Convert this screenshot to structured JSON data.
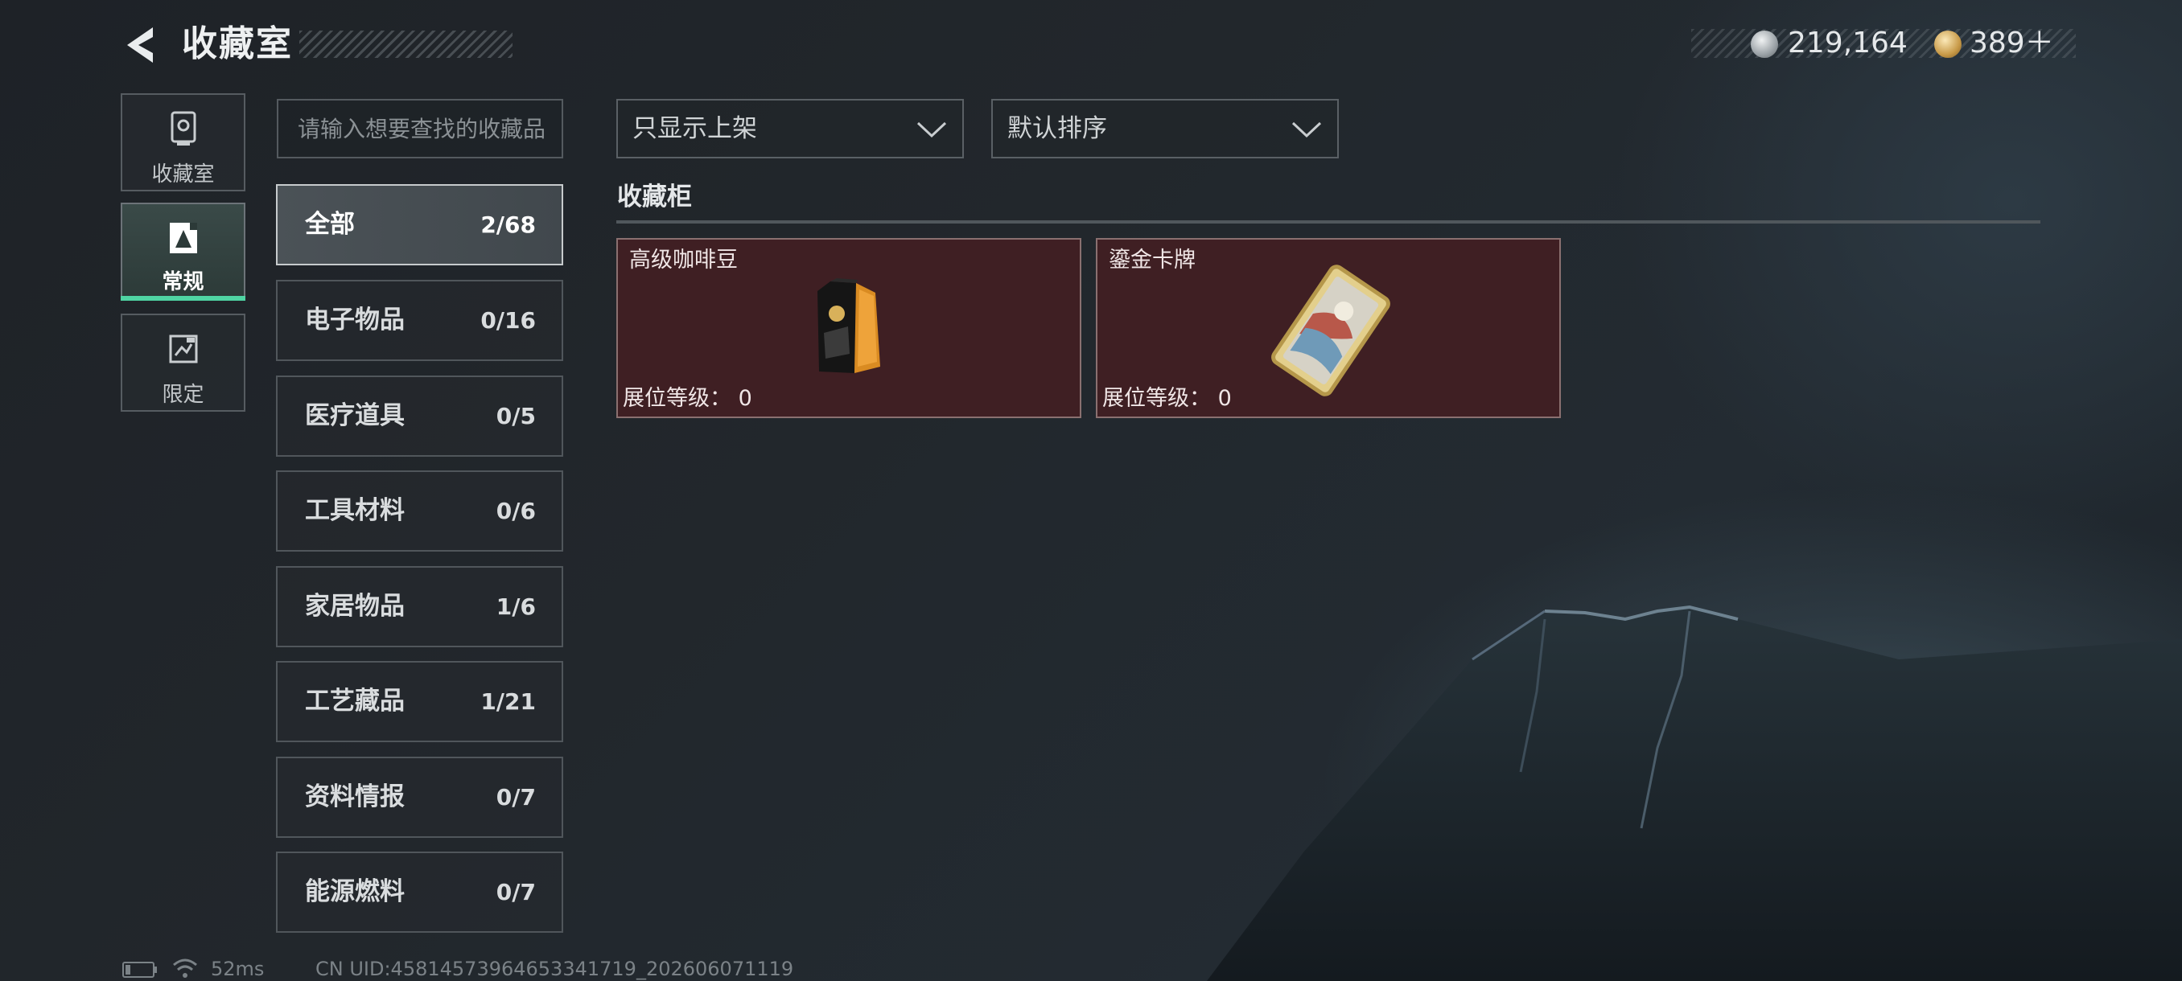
{
  "header": {
    "title": "收藏室",
    "silver_amount": "219,164",
    "gold_amount": "389＋"
  },
  "side_nav": {
    "items": [
      {
        "label": "收藏室",
        "icon": "collection-room-icon",
        "active": false
      },
      {
        "label": "常规",
        "icon": "regular-icon",
        "active": true
      },
      {
        "label": "限定",
        "icon": "limited-icon",
        "active": false
      }
    ]
  },
  "search": {
    "placeholder": "请输入想要查找的收藏品",
    "value": ""
  },
  "categories": [
    {
      "name": "全部",
      "count": "2/68",
      "active": true
    },
    {
      "name": "电子物品",
      "count": "0/16"
    },
    {
      "name": "医疗道具",
      "count": "0/5"
    },
    {
      "name": "工具材料",
      "count": "0/6"
    },
    {
      "name": "家居物品",
      "count": "1/6"
    },
    {
      "name": "工艺藏品",
      "count": "1/21"
    },
    {
      "name": "资料情报",
      "count": "0/7"
    },
    {
      "name": "能源燃料",
      "count": "0/7"
    }
  ],
  "filters": {
    "display_filter": "只显示上架",
    "sort_order": "默认排序"
  },
  "section": {
    "title": "收藏柜"
  },
  "items": [
    {
      "name": "高级咖啡豆",
      "level_label": "展位等级：",
      "level": "0",
      "icon": "coffee-bag-icon"
    },
    {
      "name": "鎏金卡牌",
      "level_label": "展位等级：",
      "level": "0",
      "icon": "gilded-card-icon"
    }
  ],
  "status": {
    "ping": "52ms",
    "uid": "CN UID:458145739646533417​19_202606071119"
  },
  "colors": {
    "accent": "#4fd4a3",
    "card_bg": "#3f1f23"
  }
}
